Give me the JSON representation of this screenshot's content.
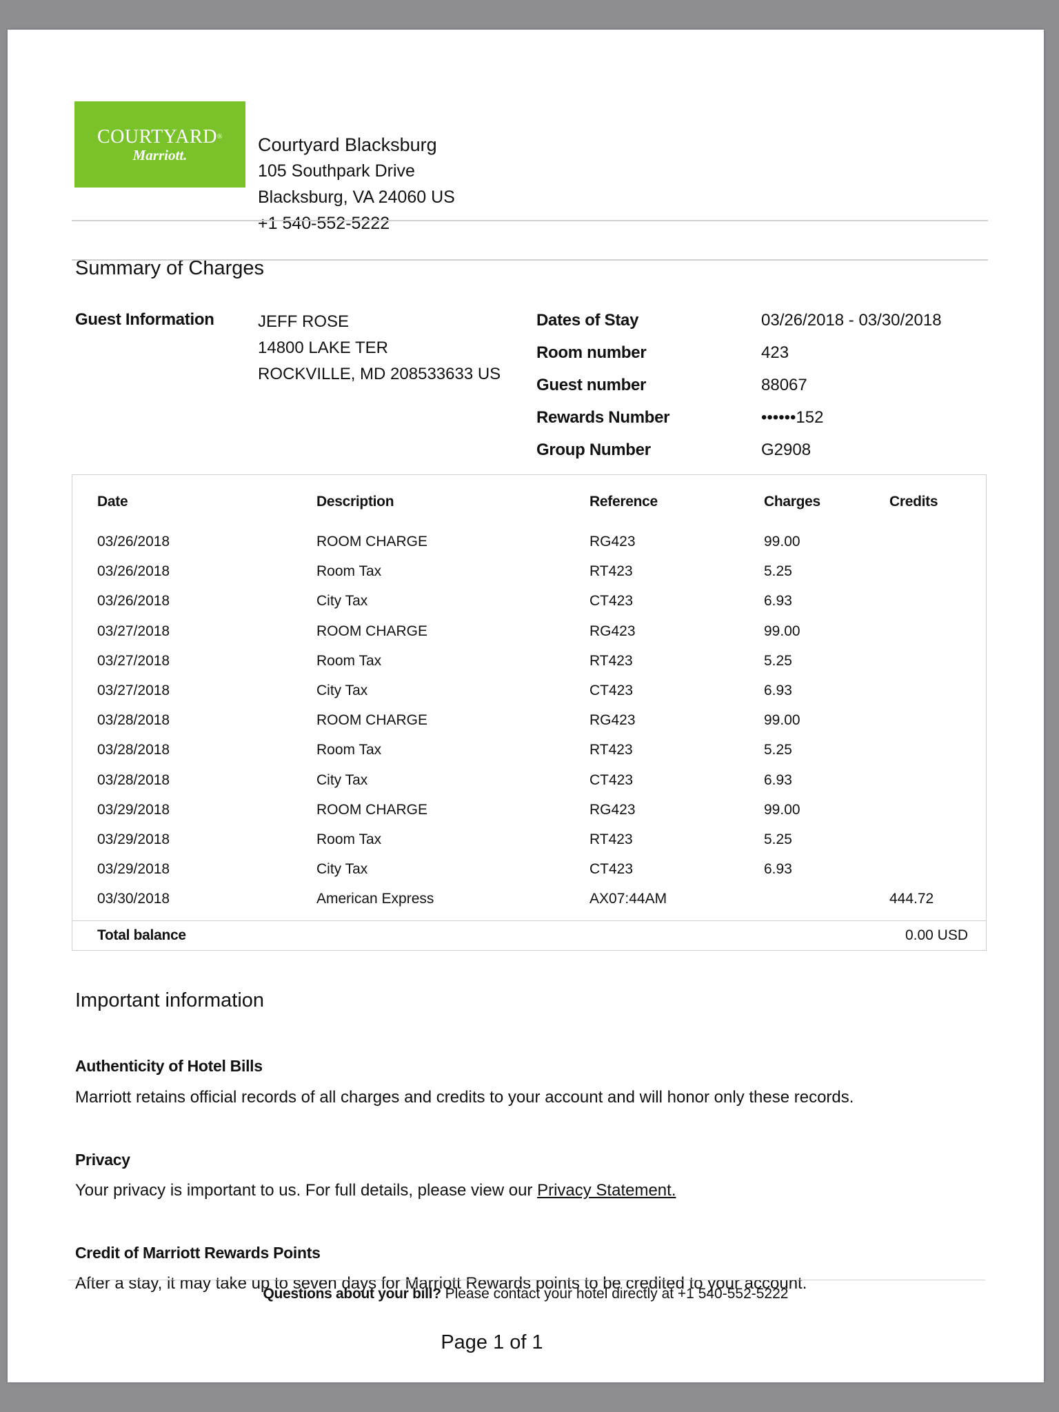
{
  "hotel": {
    "logo_line1": "COURTYARD",
    "logo_reg": "®",
    "logo_line2": "Marriott.",
    "name": "Courtyard Blacksburg",
    "address1": "105 Southpark Drive",
    "address2": "Blacksburg, VA 24060 US",
    "phone": "+1 540-552-5222",
    "brand_color": "#79c22a"
  },
  "summary_title": "Summary of Charges",
  "guest": {
    "label": "Guest Information",
    "name": "JEFF ROSE",
    "street": "14800 LAKE TER",
    "city": "ROCKVILLE, MD 208533633 US"
  },
  "stay": [
    {
      "label": "Dates of Stay",
      "value": "03/26/2018 - 03/30/2018"
    },
    {
      "label": "Room number",
      "value": "423"
    },
    {
      "label": "Guest number",
      "value": "88067"
    },
    {
      "label": "Rewards Number",
      "value": "••••••152"
    },
    {
      "label": "Group Number",
      "value": "G2908"
    }
  ],
  "table": {
    "headers": [
      "Date",
      "Description",
      "Reference",
      "Charges",
      "Credits"
    ],
    "rows": [
      [
        "03/26/2018",
        "ROOM CHARGE",
        "RG423",
        "99.00",
        ""
      ],
      [
        "03/26/2018",
        "Room Tax",
        "RT423",
        "5.25",
        ""
      ],
      [
        "03/26/2018",
        "City Tax",
        "CT423",
        "6.93",
        ""
      ],
      [
        "03/27/2018",
        "ROOM CHARGE",
        "RG423",
        "99.00",
        ""
      ],
      [
        "03/27/2018",
        "Room Tax",
        "RT423",
        "5.25",
        ""
      ],
      [
        "03/27/2018",
        "City Tax",
        "CT423",
        "6.93",
        ""
      ],
      [
        "03/28/2018",
        "ROOM CHARGE",
        "RG423",
        "99.00",
        ""
      ],
      [
        "03/28/2018",
        "Room Tax",
        "RT423",
        "5.25",
        ""
      ],
      [
        "03/28/2018",
        "City Tax",
        "CT423",
        "6.93",
        ""
      ],
      [
        "03/29/2018",
        "ROOM CHARGE",
        "RG423",
        "99.00",
        ""
      ],
      [
        "03/29/2018",
        "Room Tax",
        "RT423",
        "5.25",
        ""
      ],
      [
        "03/29/2018",
        "City Tax",
        "CT423",
        "6.93",
        ""
      ],
      [
        "03/30/2018",
        "American Express",
        "AX07:44AM",
        "",
        "444.72"
      ]
    ],
    "total_label": "Total balance",
    "total_value": "0.00 USD"
  },
  "important": {
    "title": "Important information",
    "auth_title": "Authenticity of Hotel Bills",
    "auth_body": "Marriott retains official records of all charges and credits to your account and will honor only these records.",
    "privacy_title": "Privacy",
    "privacy_body": "Your privacy is important to us. For full details, please view our ",
    "privacy_link": "Privacy Statement.",
    "rewards_title": "Credit of Marriott Rewards Points",
    "rewards_body": "After a stay, it may take up to seven days for Marriott Rewards points to be credited to your account."
  },
  "footer": {
    "question": "Questions about your bill?",
    "contact": " Please contact your hotel directly at +1 540-552-5222",
    "page": "Page 1 of 1"
  }
}
